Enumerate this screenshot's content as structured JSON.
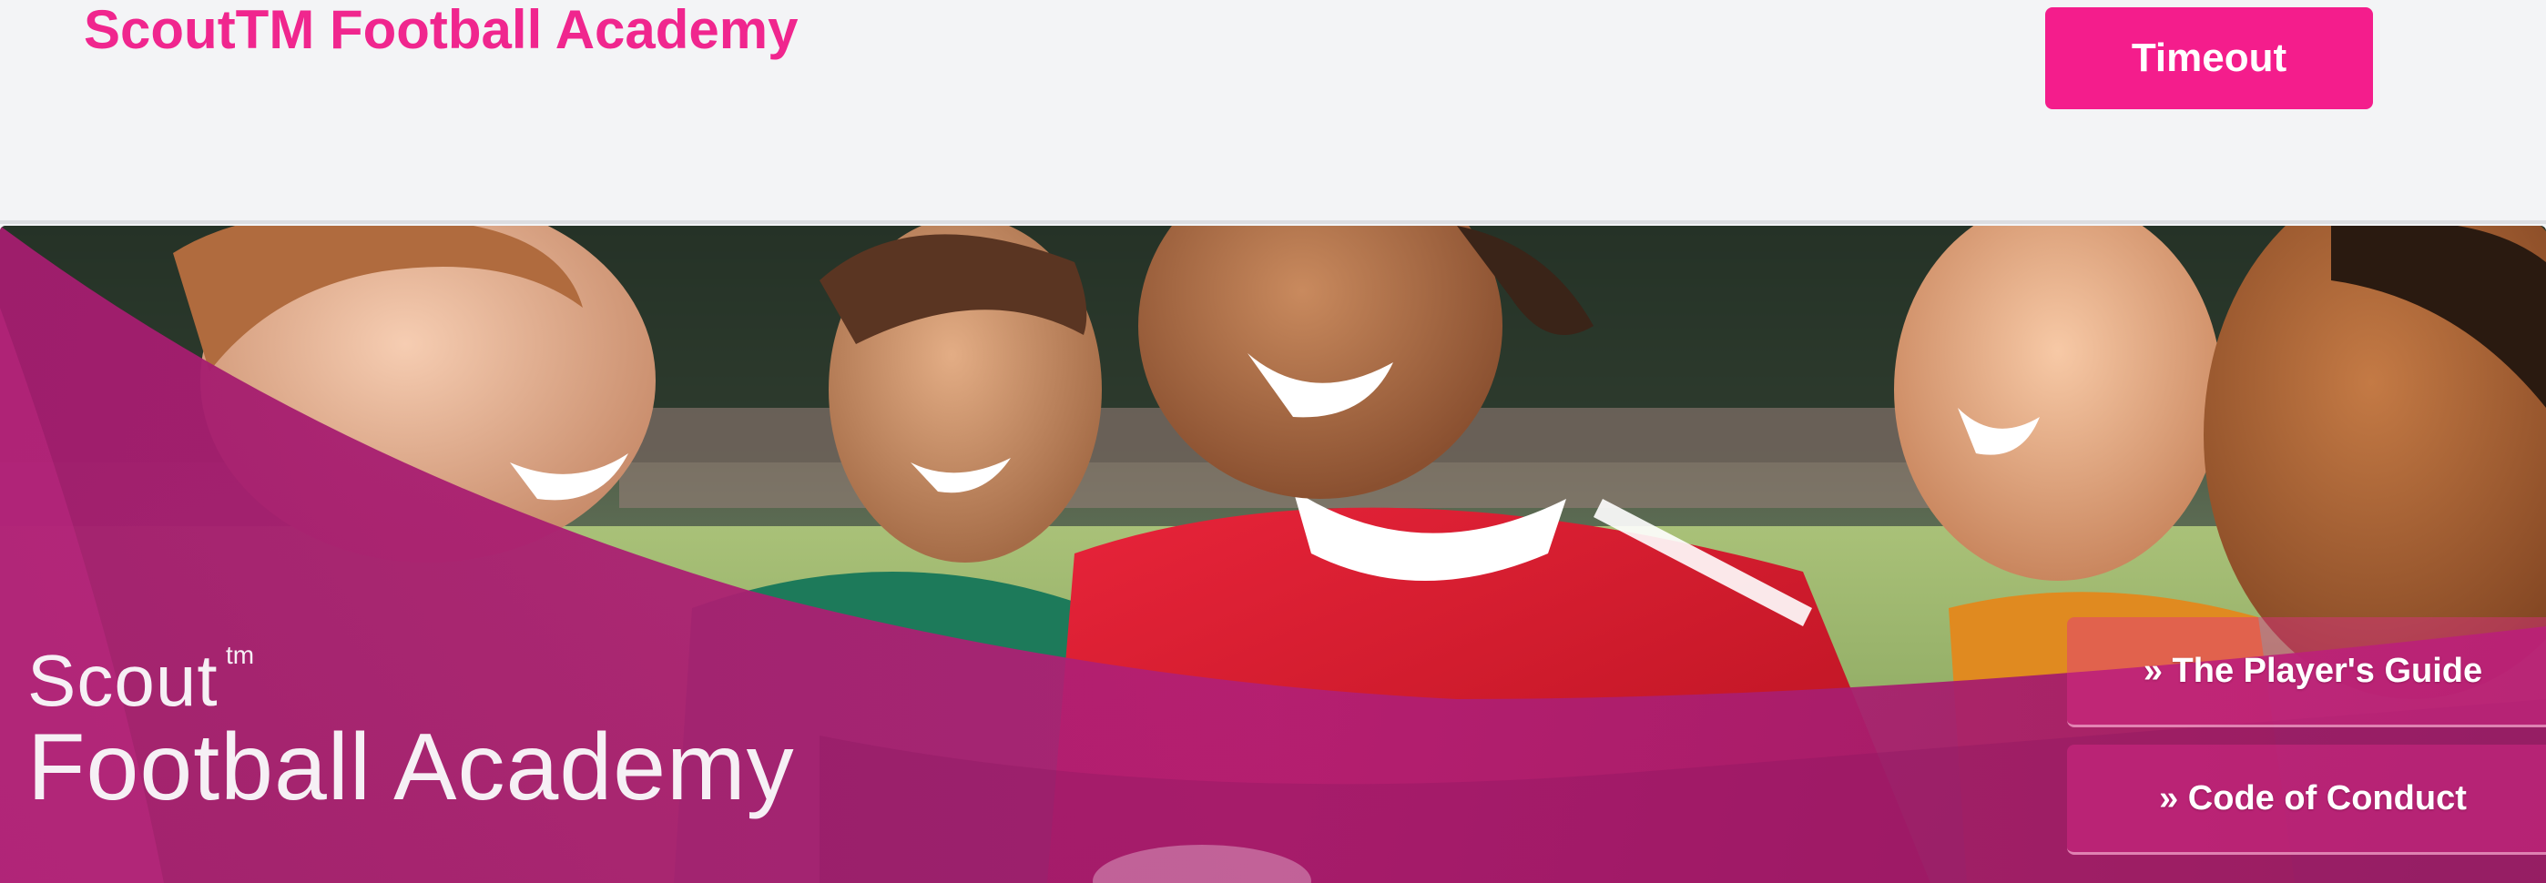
{
  "header": {
    "site_title": "ScoutTM Football Academy",
    "timeout_label": "Timeout"
  },
  "banner": {
    "brand_scout": "Scout",
    "brand_tm": "tm",
    "brand_academy": "Football Academy",
    "links": [
      {
        "label": "» The Player's Guide"
      },
      {
        "label": "» Code of Conduct"
      }
    ]
  },
  "colors": {
    "accent": "#f41d8c",
    "title": "#f0268e",
    "banner_overlay": "#9e1f6c",
    "background": "#f3f4f6"
  }
}
